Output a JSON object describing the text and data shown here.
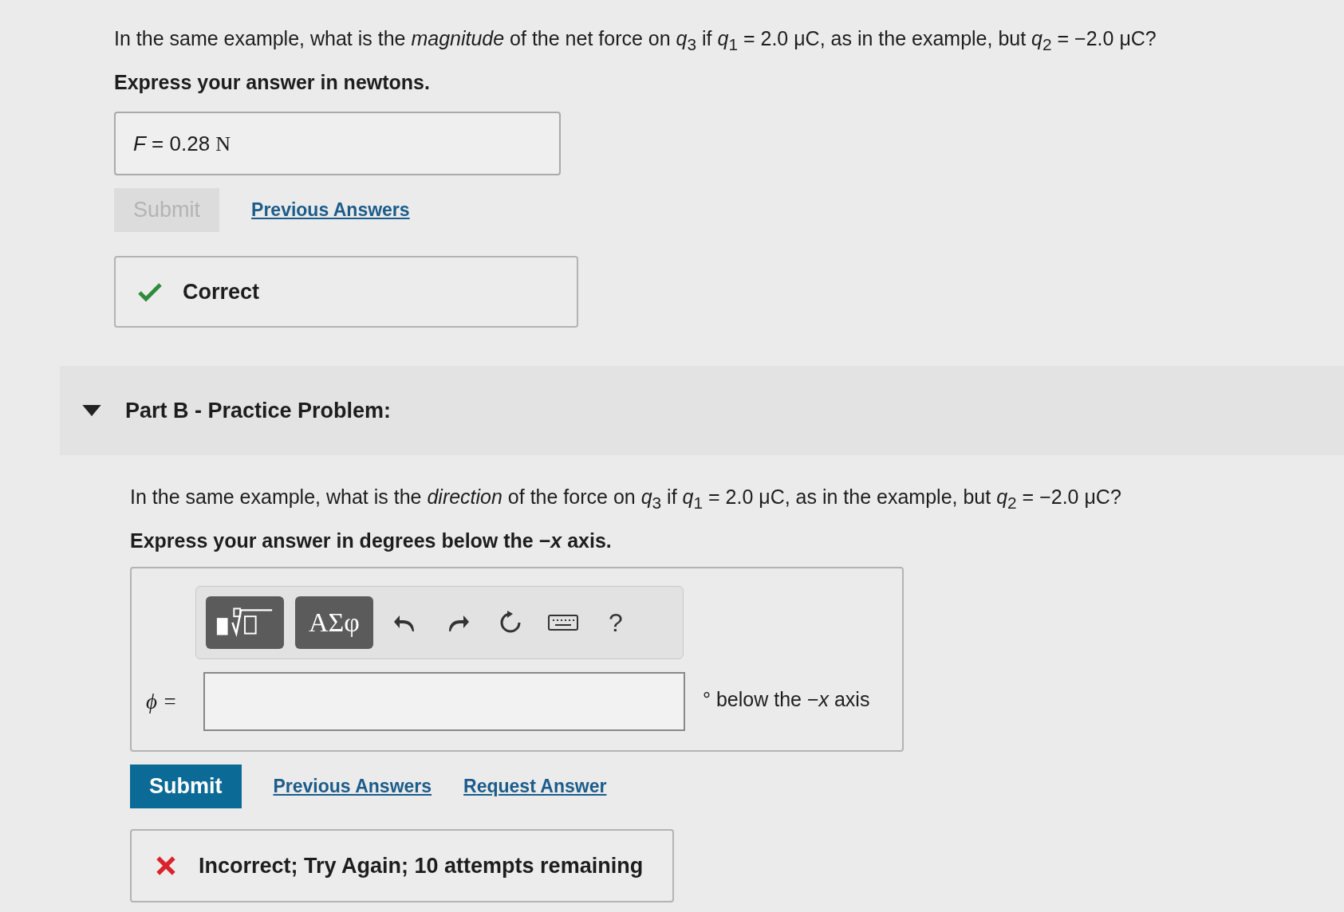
{
  "part_a": {
    "question": "In the same example, what is the *magnitude* of the net force on *q*$_{3}$ if *q*$_{1}$ = 2.0 μC, as in the example, but *q*$_{2}$ = −2.0 μC?",
    "instruction": "Express your answer in newtons.",
    "answer": {
      "variable": "F",
      "equals": "=",
      "value": "0.28",
      "unit": "N"
    },
    "submit": {
      "label": "Submit",
      "disabled": true
    },
    "links": [
      "Previous Answers"
    ],
    "feedback": {
      "kind": "correct",
      "text": "Correct"
    }
  },
  "part_b": {
    "title": "Part B - Practice Problem:",
    "expanded": true,
    "question": "In the same example, what is the *direction* of the force on *q*$_{3}$ if *q*$_{1}$ = 2.0 μC, as in the example, but *q*$_{2}$ = −2.0 μC?",
    "instruction": "Express your answer in degrees below the −*x* axis.",
    "toolbar": {
      "symbols": "ΑΣφ",
      "help": "?"
    },
    "field": {
      "label": "ϕ =",
      "unit": "° below the −*x* axis"
    },
    "submit": {
      "label": "Submit",
      "disabled": false
    },
    "links": [
      "Previous Answers",
      "Request Answer"
    ],
    "feedback": {
      "kind": "incorrect",
      "text": "Incorrect; Try Again; 10 attempts remaining"
    }
  }
}
